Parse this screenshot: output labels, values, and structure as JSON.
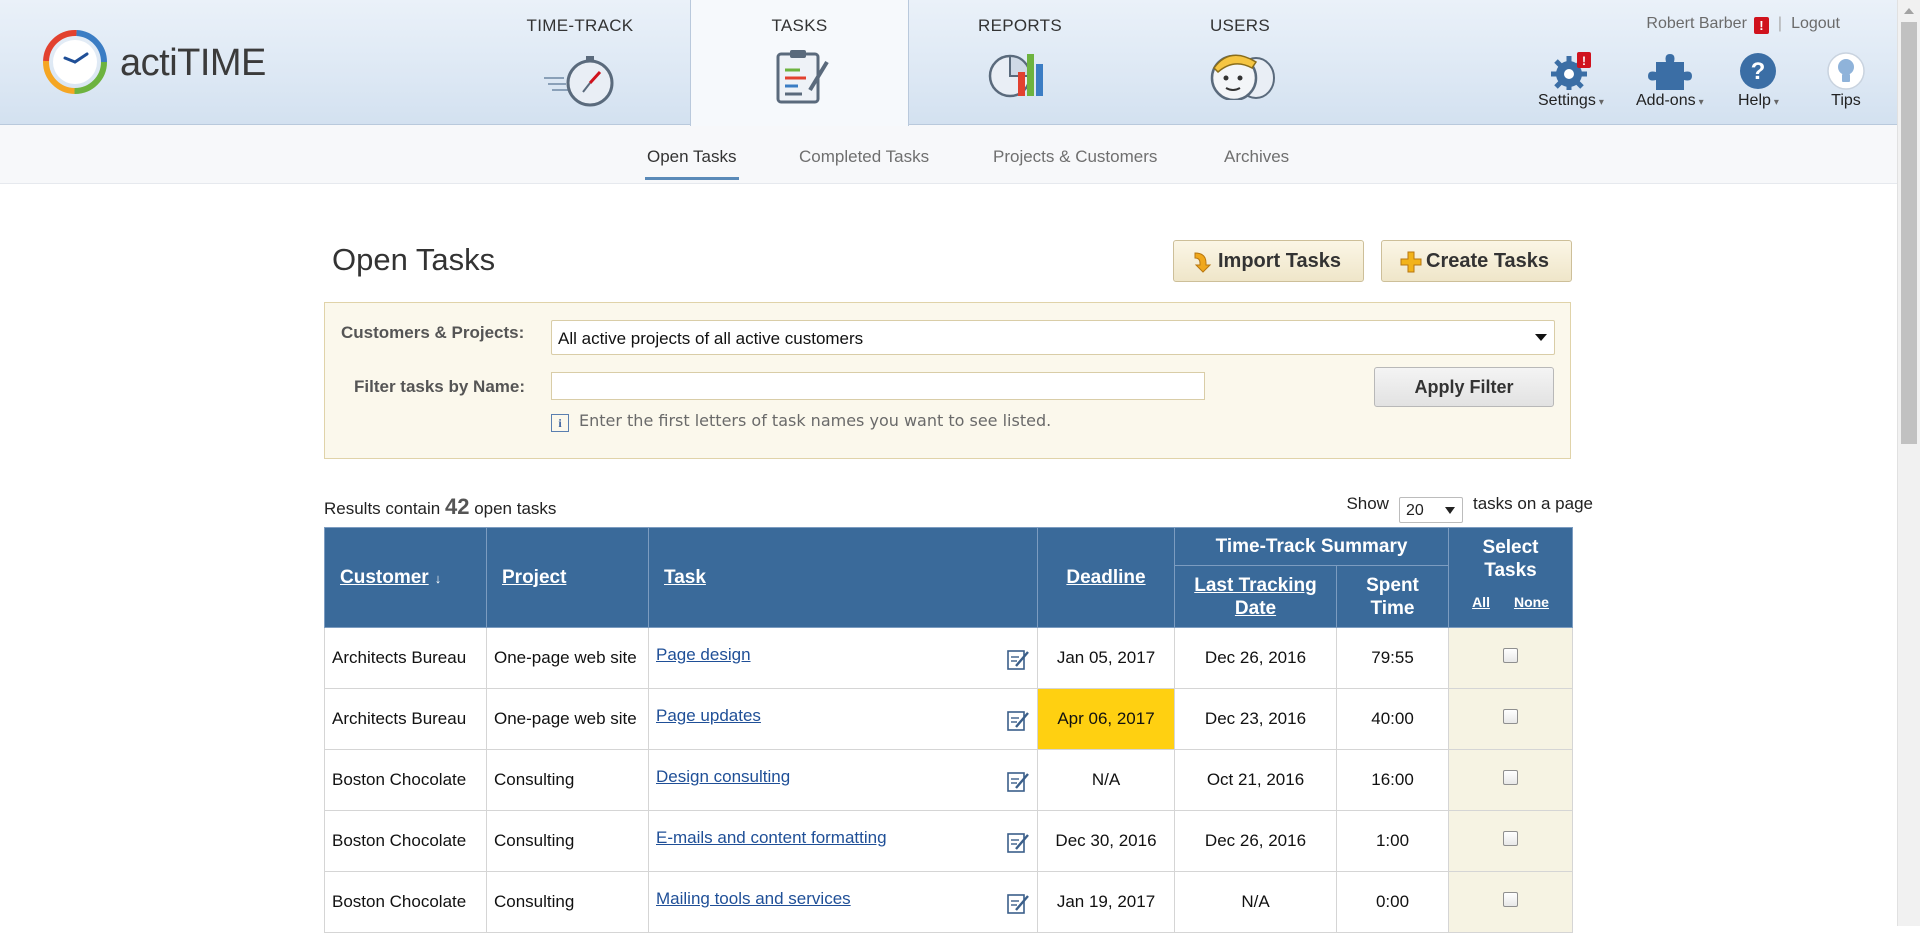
{
  "app": {
    "name": "actiTIME"
  },
  "nav": {
    "tabs": [
      {
        "label": "TIME-TRACK",
        "icon": "stopwatch-icon"
      },
      {
        "label": "TASKS",
        "icon": "clipboard-icon",
        "active": true
      },
      {
        "label": "REPORTS",
        "icon": "charts-icon"
      },
      {
        "label": "USERS",
        "icon": "users-icon"
      }
    ]
  },
  "user": {
    "name": "Robert Barber",
    "warning": "!",
    "logout": "Logout"
  },
  "tools": {
    "settings": {
      "label": "Settings",
      "badge": "!"
    },
    "addons": {
      "label": "Add-ons"
    },
    "help": {
      "label": "Help"
    },
    "tips": {
      "label": "Tips"
    }
  },
  "subtabs": [
    {
      "label": "Open Tasks",
      "active": true
    },
    {
      "label": "Completed Tasks"
    },
    {
      "label": "Projects & Customers"
    },
    {
      "label": "Archives"
    }
  ],
  "page": {
    "title": "Open Tasks",
    "import_button": "Import Tasks",
    "create_button": "Create Tasks"
  },
  "filter": {
    "customers_label": "Customers & Projects:",
    "customers_value": "All active projects of all active customers",
    "name_label": "Filter tasks by Name:",
    "name_value": "",
    "apply_button": "Apply Filter",
    "hint": "Enter the first letters of task names you want to see listed."
  },
  "results": {
    "prefix": "Results contain",
    "count": "42",
    "suffix": "open tasks",
    "show_label": "Show",
    "per_page": "20",
    "per_page_suffix": "tasks on a page"
  },
  "table": {
    "headers": {
      "customer": "Customer",
      "project": "Project",
      "task": "Task",
      "deadline": "Deadline",
      "summary": "Time-Track Summary",
      "last_tracking": "Last Tracking Date",
      "spent": "Spent Time",
      "select": "Select Tasks",
      "all": "All",
      "none": "None"
    },
    "rows": [
      {
        "customer": "Architects Bureau",
        "project": "One-page web site",
        "task": "Page design",
        "deadline": "Jan 05, 2017",
        "deadline_style": "red",
        "last": "Dec 26, 2016",
        "spent": "79:55"
      },
      {
        "customer": "Architects Bureau",
        "project": "One-page web site",
        "task": "Page updates",
        "deadline": "Apr 06, 2017",
        "deadline_style": "highlight",
        "last": "Dec 23, 2016",
        "spent": "40:00"
      },
      {
        "customer": "Boston Chocolate",
        "project": "Consulting",
        "task": "Design consulting",
        "deadline": "N/A",
        "deadline_style": "normal",
        "last": "Oct 21, 2016",
        "spent": "16:00"
      },
      {
        "customer": "Boston Chocolate",
        "project": "Consulting",
        "task": "E-mails and content formatting",
        "deadline": "Dec 30, 2016",
        "deadline_style": "red",
        "last": "Dec 26, 2016",
        "spent": "1:00"
      },
      {
        "customer": "Boston Chocolate",
        "project": "Consulting",
        "task": "Mailing tools and services",
        "deadline": "Jan 19, 2017",
        "deadline_style": "normal",
        "last": "N/A",
        "spent": "0:00"
      }
    ]
  },
  "colors": {
    "header_blue": "#3a6a9a",
    "deadline_red": "#d01b1b",
    "deadline_highlight": "#ffd011"
  }
}
